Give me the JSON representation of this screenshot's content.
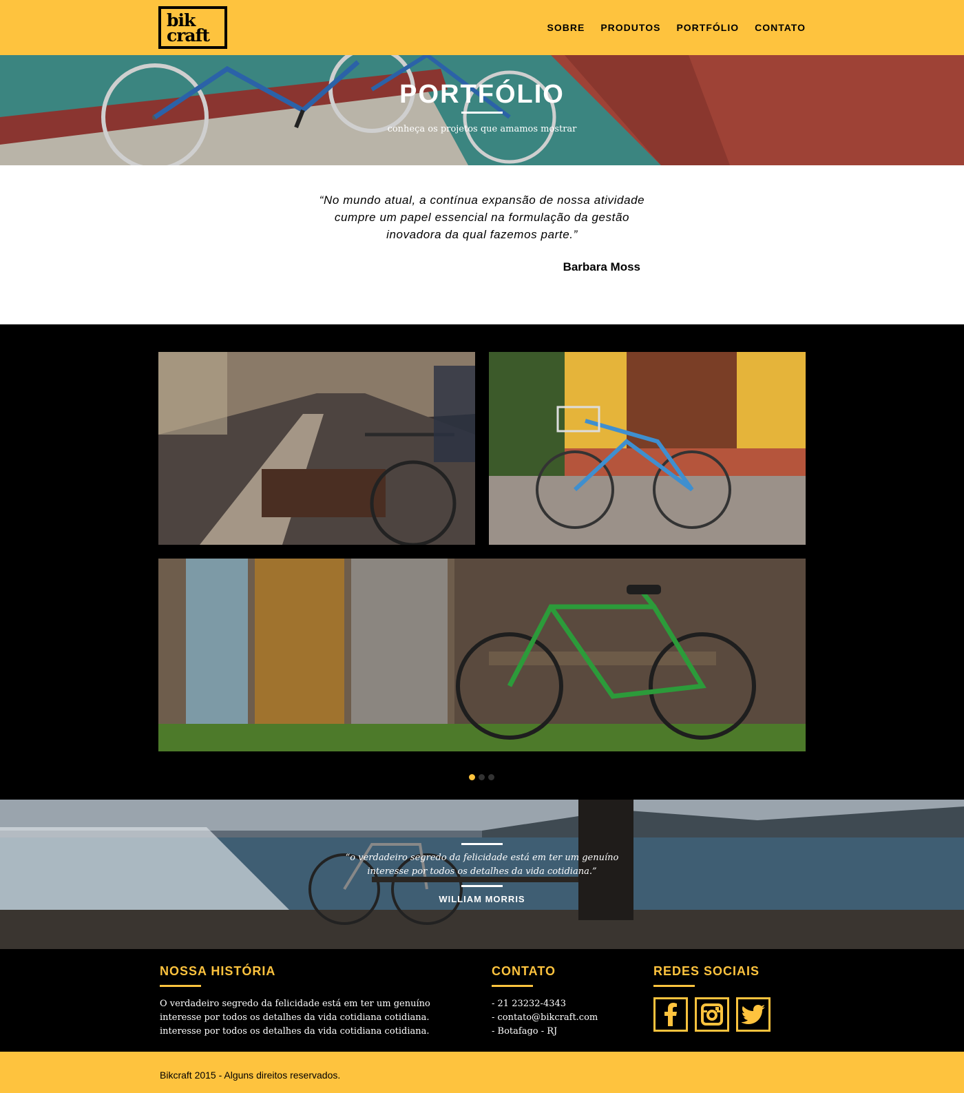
{
  "header": {
    "logo_line1": "bik",
    "logo_line2": "craft",
    "nav": [
      "SOBRE",
      "PRODUTOS",
      "PORTFÓLIO",
      "CONTATO"
    ]
  },
  "hero": {
    "title": "PORTFÓLIO",
    "subtitle": "conheça os projetos que amamos mostrar"
  },
  "quote": {
    "text": "“No mundo atual, a contínua expansão de nossa atividade cumpre um papel essencial na formulação da gestão inovadora da qual fazemos parte.”",
    "author": "Barbara Moss"
  },
  "gallery": {
    "slide_count": 3,
    "active_slide": 1
  },
  "parallax": {
    "quote": "“o verdadeiro segredo da felicidade está em ter um genuíno interesse por todos os detalhes da vida cotidiana.”",
    "author": "WILLIAM MORRIS"
  },
  "footer": {
    "history": {
      "title": "NOSSA HISTÓRIA",
      "text": "O verdadeiro segredo da felicidade está em ter um genuíno interesse por todos os detalhes da vida cotidiana cotidiana. interesse por todos os detalhes da vida cotidiana cotidiana."
    },
    "contact": {
      "title": "CONTATO",
      "items": [
        "- 21 23232-4343",
        "- contato@bikcraft.com",
        "- Botafago - RJ"
      ]
    },
    "social": {
      "title": "REDES SOCIAIS",
      "icons": [
        "facebook-icon",
        "instagram-icon",
        "twitter-icon"
      ]
    }
  },
  "copyright": "Bikcraft 2015 - Alguns direitos reservados.",
  "colors": {
    "brand_yellow": "#fec33e",
    "black": "#000000"
  }
}
